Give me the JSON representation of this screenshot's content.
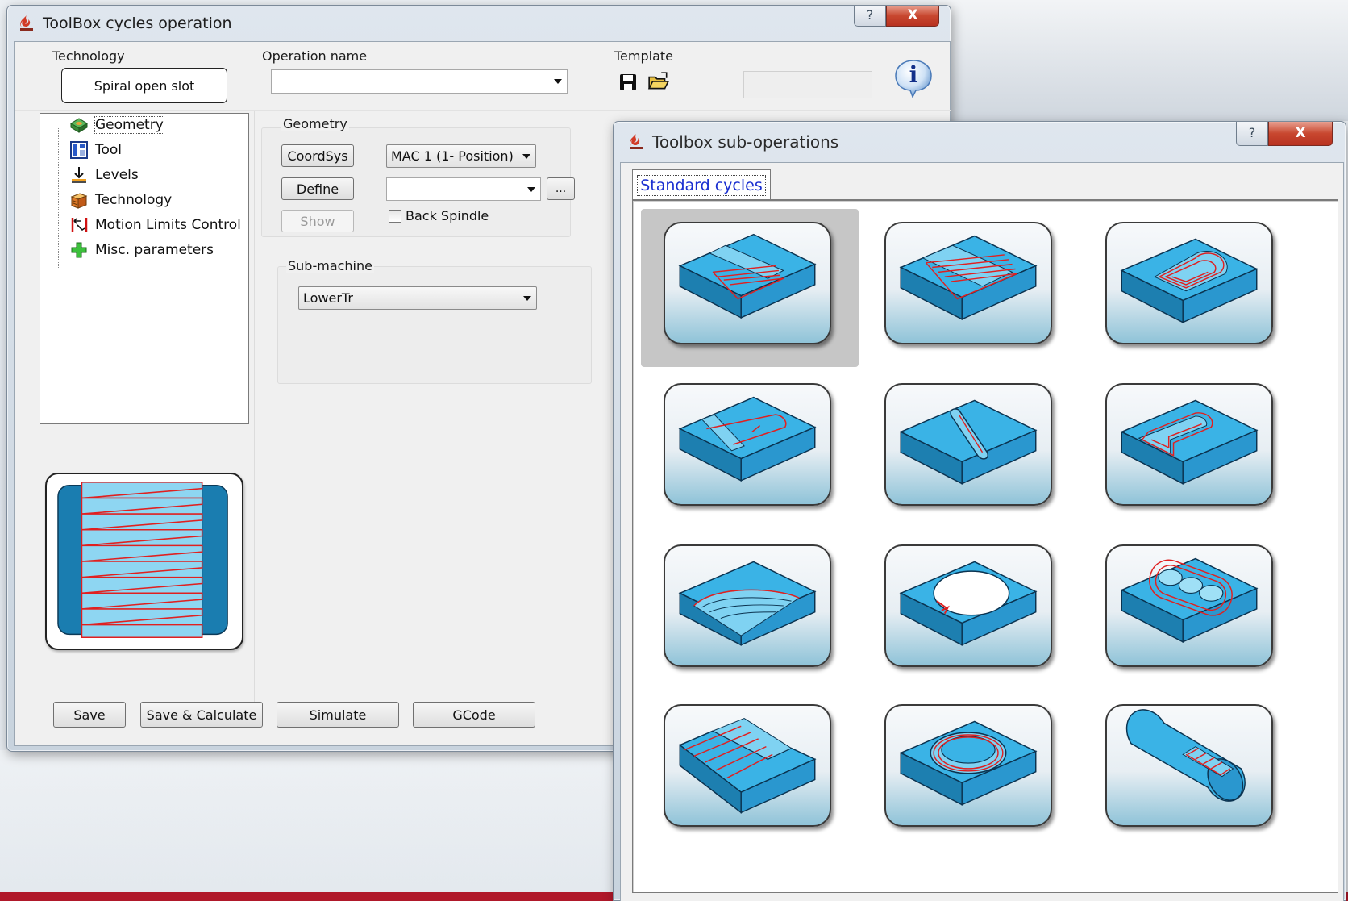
{
  "main_window": {
    "title": "ToolBox cycles operation",
    "help_glyph": "?",
    "close_glyph": "X",
    "technology": {
      "label": "Technology",
      "value": "Spiral open slot"
    },
    "operation_name": {
      "label": "Operation name",
      "value": ""
    },
    "template": {
      "label": "Template",
      "value": "",
      "save_icon": "floppy-disk-icon",
      "open_icon": "open-folder-icon"
    },
    "info_icon": "info-icon",
    "info_glyph": "i",
    "tree": [
      {
        "label": "Geometry",
        "icon": "geometry-icon",
        "selected": true
      },
      {
        "label": "Tool",
        "icon": "tool-icon"
      },
      {
        "label": "Levels",
        "icon": "levels-icon"
      },
      {
        "label": "Technology",
        "icon": "technology-icon"
      },
      {
        "label": "Motion Limits Control",
        "icon": "motion-limits-icon"
      },
      {
        "label": "Misc. parameters",
        "icon": "misc-parameters-icon"
      }
    ],
    "geometry_group": {
      "label": "Geometry",
      "coordsys_button": "CoordSys",
      "coordsys_value": "MAC 1 (1- Position)",
      "define_button": "Define",
      "define_value": "",
      "ellipsis_button": "...",
      "show_button": "Show",
      "back_spindle": {
        "label": "Back Spindle",
        "checked": false
      }
    },
    "submachine_group": {
      "label": "Sub-machine",
      "value": "LowerTr"
    },
    "footer_buttons": [
      "Save",
      "Save & Calculate",
      "Simulate",
      "GCode"
    ]
  },
  "sub_window": {
    "title": "Toolbox sub-operations",
    "help_glyph": "?",
    "close_glyph": "X",
    "tab": "Standard cycles",
    "tiles": [
      {
        "icon": "open-slot-parallel-icon",
        "selected": true
      },
      {
        "icon": "open-slot-wide-icon"
      },
      {
        "icon": "closed-pocket-slot-icon"
      },
      {
        "icon": "open-slot-contour-icon"
      },
      {
        "icon": "closed-slot-icon"
      },
      {
        "icon": "slot-u-contour-icon"
      },
      {
        "icon": "surface-pocket-icon"
      },
      {
        "icon": "circular-pocket-icon"
      },
      {
        "icon": "bosses-contour-icon"
      },
      {
        "icon": "chamfer-slot-icon"
      },
      {
        "icon": "circular-groove-icon"
      },
      {
        "icon": "cylinder-slot-icon"
      }
    ]
  },
  "colors": {
    "part_blue": "#3ab3e6",
    "part_dark": "#1d7fb0",
    "toolpath_red": "#e02020",
    "tab_text": "#1a2fd0",
    "close_red": "#c8472f"
  }
}
